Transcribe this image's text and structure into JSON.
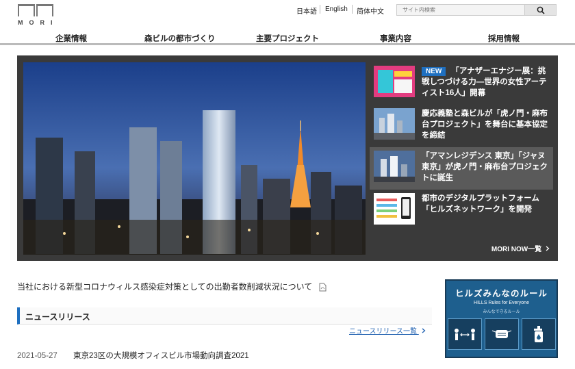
{
  "header": {
    "logo_text": "MORI",
    "lang_ja": "日本語",
    "lang_en": "English",
    "lang_zh": "简体中文",
    "search_placeholder": "サイト内検索"
  },
  "nav": [
    {
      "label": "企業情報"
    },
    {
      "label": "森ビルの都市づくり"
    },
    {
      "label": "主要プロジェクト"
    },
    {
      "label": "事業内容"
    },
    {
      "label": "採用情報"
    }
  ],
  "hero": {
    "news": [
      {
        "badge": "NEW",
        "text": "「アナザーエナジー展：挑戦しつづける力―世界の女性アーティスト16人」開幕"
      },
      {
        "text": "慶応義塾と森ビルが「虎ノ門・麻布台プロジェクト」を舞台に基本協定を締結"
      },
      {
        "text": "「アマンレジデンス 東京」「ジャヌ東京」が虎ノ門・麻布台プロジェクトに誕生"
      },
      {
        "text": "都市のデジタルプラットフォーム「ヒルズネットワーク」を開発"
      }
    ],
    "more_label": "MORI NOW一覧"
  },
  "notice": "当社における新型コロナウィルス感染症対策としての出勤者数削減状況について",
  "news_section": {
    "heading": "ニュースリリース",
    "list_link": "ニュースリリース一覧",
    "items": [
      {
        "date": "2021-05-27",
        "title": "東京23区の大規模オフィスビル市場動向調査2021"
      }
    ]
  },
  "banner": {
    "title": "ヒルズみんなのルール",
    "subtitle": "HILLS Rules for Everyone",
    "caption": "みんなで守るルール"
  },
  "colors": {
    "accent": "#1e6fc0",
    "hero_bg": "#3a3a3a",
    "banner_bg": "#1e5f8e"
  }
}
